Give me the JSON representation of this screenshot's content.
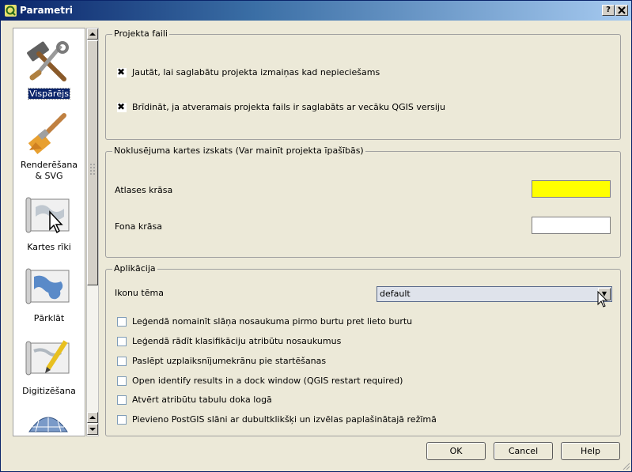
{
  "window": {
    "title": "Parametri",
    "help_btn": "?",
    "close_btn": "X"
  },
  "sidebar": {
    "items": [
      {
        "label": "Vispārējs",
        "icon": "tools-icon",
        "selected": true
      },
      {
        "label": "Renderēšana\n& SVG",
        "label_line1": "Renderēšana",
        "label_line2": "& SVG",
        "icon": "paintbrush-icon"
      },
      {
        "label": "Kartes rīki",
        "icon": "map-cursor-icon"
      },
      {
        "label": "Pārklāt",
        "icon": "map-overlay-icon"
      },
      {
        "label": "Digitizēšana",
        "icon": "map-pencil-icon"
      },
      {
        "label": "",
        "icon": "globe-grid-icon"
      }
    ]
  },
  "groups": {
    "projekta": {
      "title": "Projekta faili",
      "options": [
        {
          "label": "Jautāt, lai saglabātu projekta izmaiņas kad nepieciešams",
          "checked": true
        },
        {
          "label": "Brīdināt, ja atveramais projekta fails ir saglabāts ar vecāku QGIS versiju",
          "checked": true
        }
      ]
    },
    "noklusejuma": {
      "title": "Noklusējuma kartes izskats (Var mainīt projekta īpašībās)",
      "selection_label": "Atlases krāsa",
      "selection_color": "#ffff00",
      "background_label": "Fona krāsa",
      "background_color": "#ffffff"
    },
    "aplikacija": {
      "title": "Aplikācija",
      "icon_theme_label": "Ikonu tēma",
      "icon_theme_value": "default",
      "options": [
        {
          "label": "Leģendā nomainīt slāņa nosaukuma pirmo burtu pret lieto burtu",
          "checked": false
        },
        {
          "label": "Leģendā rādīt klasifikāciju atribūtu nosaukumus",
          "checked": false
        },
        {
          "label": "Paslēpt uzplaiksnījumekrānu pie startēšanas",
          "checked": false
        },
        {
          "label": "Open identify results in a dock window (QGIS restart required)",
          "checked": false
        },
        {
          "label": "Atvērt atribūtu tabulu doka logā",
          "checked": false
        },
        {
          "label": "Pievieno PostGIS slāni ar dubultklikšķi un izvēlas paplašinātajā režīmā",
          "checked": false
        }
      ]
    }
  },
  "buttons": {
    "ok": "OK",
    "cancel": "Cancel",
    "help": "Help"
  }
}
